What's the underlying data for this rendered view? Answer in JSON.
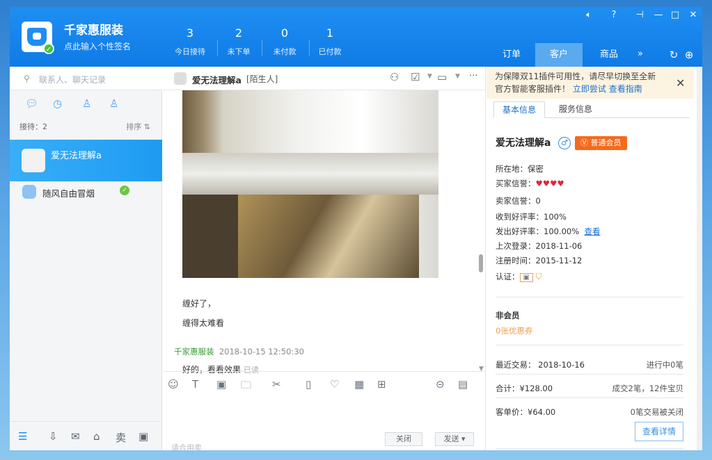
{
  "app": {
    "shop_name": "千家惠服装",
    "signature": "点此输入个性签名"
  },
  "stats": [
    {
      "num": "3",
      "label": "今日接待"
    },
    {
      "num": "2",
      "label": "未下单"
    },
    {
      "num": "0",
      "label": "未付款"
    },
    {
      "num": "1",
      "label": "已付款"
    }
  ],
  "top_tabs": [
    "订单",
    "客户",
    "商品"
  ],
  "search": {
    "placeholder": "联系人、聊天记录"
  },
  "left": {
    "receiving": "接待：2",
    "sort": "排序"
  },
  "contacts": [
    {
      "name": "爱无法理解a"
    },
    {
      "name": "随风自由冒烟"
    }
  ],
  "chat": {
    "name": "爱无法理解a",
    "tag": "[陌生人]",
    "messages": [
      "缠好了，",
      "缠得太难看"
    ],
    "sender": "千家惠服装",
    "time": "2018-10-15 12:50:30",
    "reply": "好的，看看效果",
    "read": "已读",
    "input_hint": "请合用卖",
    "close_btn": "关闭",
    "send_btn": "发送"
  },
  "notice": {
    "text1": "为保障双11插件可用性，请尽早切换至全新",
    "text2": "官方智能客服插件！",
    "link1": "立即尝试",
    "link2": "查看指南"
  },
  "info_tabs": [
    "基本信息",
    "服务信息"
  ],
  "customer": {
    "name": "爱无法理解a",
    "member_badge": "普通会员",
    "location": "所在地：保密",
    "buyer_credit": "买家信誉：",
    "seller_credit": "卖家信誉：0",
    "good_recv": "收到好评率：100%",
    "good_sent": "发出好评率：100.00%",
    "view_link": "查看",
    "last_login": "上次登录：2018-11-06",
    "register": "注册时间：2015-11-12",
    "cert": "认证：",
    "nonmember": "非会员",
    "coupon": "0张优惠券",
    "recent": "最近交易： 2018-10-16",
    "ongoing": "进行中0笔",
    "total": "合计：¥128.00",
    "total_detail": "成交2笔，12件宝贝",
    "avg": "客单价：¥64.00",
    "closed": "0笔交易被关闭",
    "detail_btn": "查看详情"
  }
}
